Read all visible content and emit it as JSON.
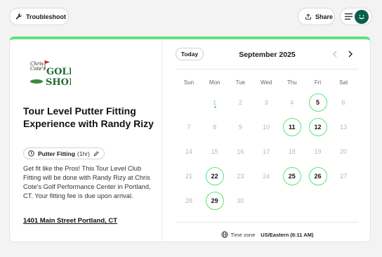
{
  "topbar": {
    "troubleshoot_label": "Troubleshoot",
    "share_label": "Share"
  },
  "event": {
    "logo": {
      "text_script": "Chris Cote's",
      "text_main": "GOLF",
      "text_sub": "SHOP"
    },
    "title": "Tour Level Putter Fitting Experience with Randy Rizy",
    "duration_name": "Putter Fitting",
    "duration_length": "(1hr)",
    "description": "Get fit like the Pros! This Tour Level Club Fitting will be done with Randy Rizy at Chris Cote's Golf Performance Center in Portland, CT. Your fitting fee is due upon arrival.",
    "address": "1401 Main Street Portland, CT"
  },
  "calendar": {
    "today_label": "Today",
    "month_label": "September 2025",
    "weekdays": [
      "Sun",
      "Mon",
      "Tue",
      "Wed",
      "Thu",
      "Fri",
      "Sat"
    ],
    "first_weekday_index": 1,
    "days_in_month": 30,
    "available_days": [
      5,
      11,
      12,
      22,
      25,
      26,
      29
    ],
    "today_day": 1
  },
  "timezone": {
    "label": "Time zone",
    "value": "US/Eastern (6:11 AM)"
  },
  "colors": {
    "accent": "#5fe37a",
    "avatar": "#0b5d4c"
  }
}
